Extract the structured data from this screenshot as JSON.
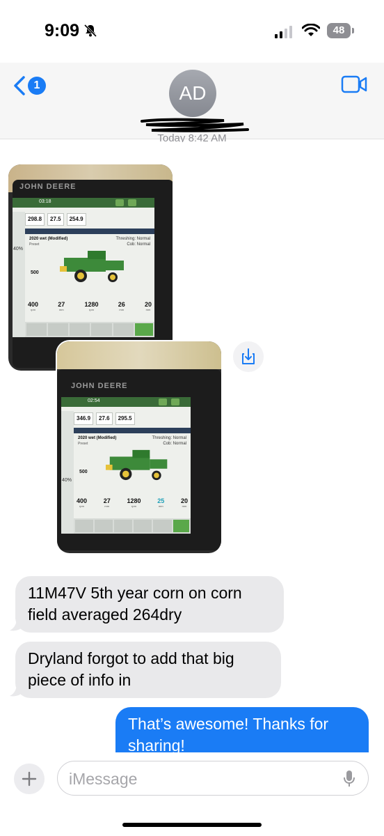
{
  "status_bar": {
    "time": "9:09",
    "battery": "48"
  },
  "header": {
    "back_badge": "1",
    "avatar_initials": "AD"
  },
  "conversation": {
    "timestamp": "Today 8:42 AM"
  },
  "photos": [
    {
      "brand": "JOHN DEERE",
      "screen_time": "03:18",
      "readouts": [
        "298.8",
        "27.5",
        "254.9"
      ],
      "setting_title": "2020 wet (Modified)",
      "setting_sub": "Preset",
      "threshing": "Threshing: Normal",
      "cob": "Cob: Normal",
      "side_values": [
        "500",
        "40%"
      ],
      "metrics": [
        {
          "value": "400",
          "unit": "rpm"
        },
        {
          "value": "27",
          "unit": "mm"
        },
        {
          "value": "1280",
          "unit": "rpm"
        },
        {
          "value": "26",
          "unit": "mm"
        },
        {
          "value": "20",
          "unit": "mm"
        }
      ]
    },
    {
      "brand": "JOHN DEERE",
      "screen_time": "02:54",
      "readouts": [
        "346.9",
        "27.6",
        "295.5"
      ],
      "setting_title": "2020 wet (Modified)",
      "setting_sub": "Preset",
      "threshing": "Threshing: Normal",
      "cob": "Cob: Normal",
      "side_values": [
        "500",
        "40%"
      ],
      "metrics": [
        {
          "value": "400",
          "unit": "rpm"
        },
        {
          "value": "27",
          "unit": "mm"
        },
        {
          "value": "1280",
          "unit": "rpm"
        },
        {
          "value": "25",
          "unit": "mm"
        },
        {
          "value": "20",
          "unit": "mm"
        }
      ]
    }
  ],
  "messages": [
    {
      "from": "contact",
      "text": "11M47V 5th year corn on corn field averaged 264dry"
    },
    {
      "from": "contact",
      "text": "Dryland forgot to add that big piece of info in"
    },
    {
      "from": "me",
      "text": "That’s awesome! Thanks for sharing!"
    }
  ],
  "input": {
    "placeholder": "iMessage"
  },
  "colors": {
    "accent": "#1a7cf5",
    "incoming_bubble": "#e9e9eb",
    "deere_green": "#3a6b38"
  }
}
